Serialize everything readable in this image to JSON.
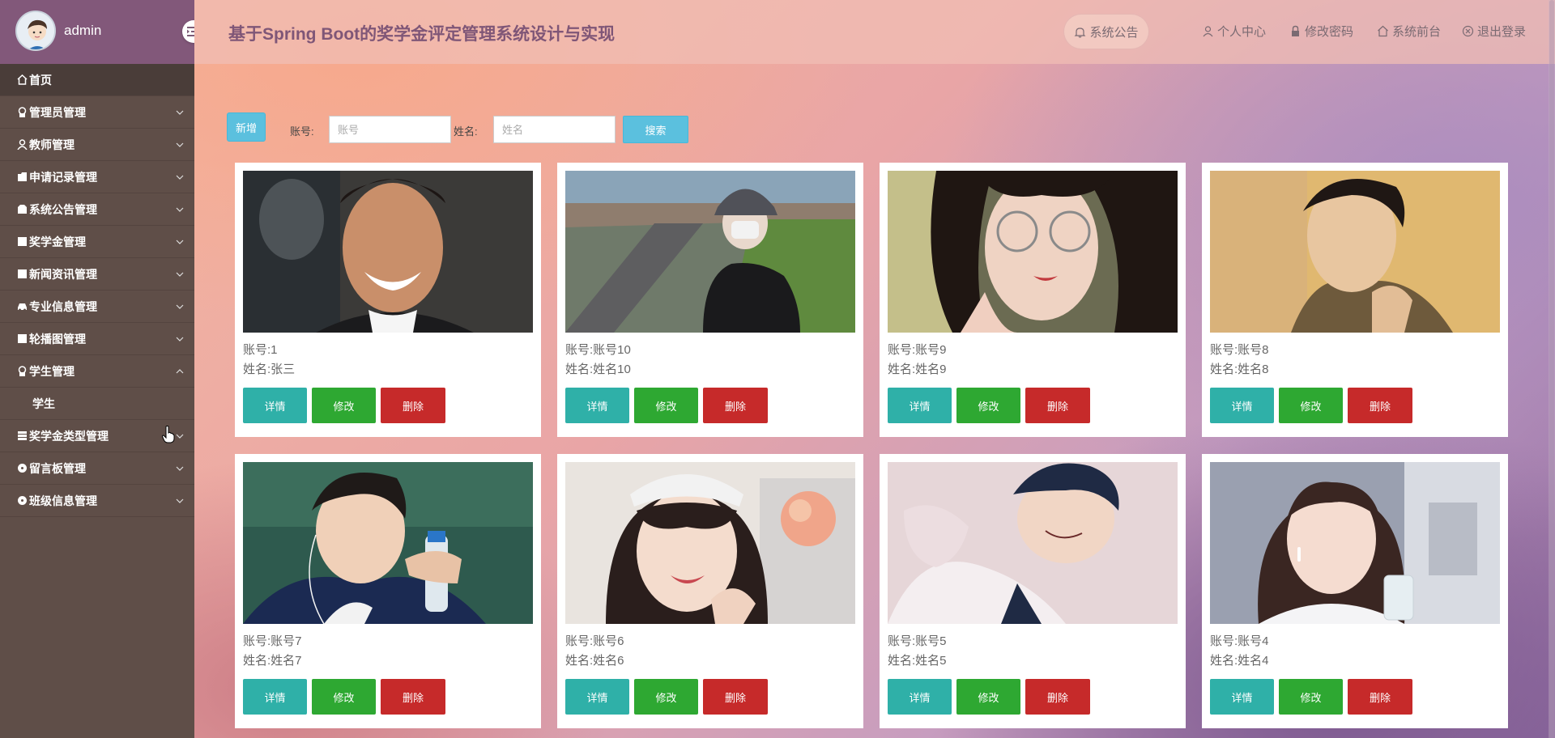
{
  "user": {
    "name": "admin"
  },
  "header": {
    "title": "基于Spring Boot的奖学金评定管理系统设计与实现",
    "notice": "系统公告",
    "links": {
      "profile": "个人中心",
      "password": "修改密码",
      "frontend": "系统前台",
      "logout": "退出登录"
    }
  },
  "sidebar": {
    "items": [
      {
        "label": "首页",
        "icon": "home-icon"
      },
      {
        "label": "管理员管理",
        "icon": "lock-icon"
      },
      {
        "label": "教师管理",
        "icon": "user-icon"
      },
      {
        "label": "申请记录管理",
        "icon": "folder-icon"
      },
      {
        "label": "系统公告管理",
        "icon": "bag-icon"
      },
      {
        "label": "奖学金管理",
        "icon": "square-icon"
      },
      {
        "label": "新闻资讯管理",
        "icon": "square-icon"
      },
      {
        "label": "专业信息管理",
        "icon": "car-icon"
      },
      {
        "label": "轮播图管理",
        "icon": "square-icon"
      },
      {
        "label": "学生管理",
        "icon": "lock-icon"
      },
      {
        "label": "奖学金类型管理",
        "icon": "list-icon"
      },
      {
        "label": "留言板管理",
        "icon": "circle-icon"
      },
      {
        "label": "班级信息管理",
        "icon": "circle-icon"
      }
    ],
    "student_sub": "学生"
  },
  "search": {
    "add_label": "新增",
    "account_label": "账号:",
    "account_placeholder": "账号",
    "name_label": "姓名:",
    "name_placeholder": "姓名",
    "search_label": "搜索"
  },
  "card_labels": {
    "account": "账号:",
    "name": "姓名:",
    "detail": "详情",
    "edit": "修改",
    "delete": "删除"
  },
  "cards": [
    {
      "account": "1",
      "name": "张三",
      "photo": "photo-smiling-young-man"
    },
    {
      "account": "账号10",
      "name": "姓名10",
      "photo": "photo-girl-masked-on-road"
    },
    {
      "account": "账号9",
      "name": "姓名9",
      "photo": "photo-girl-with-glasses"
    },
    {
      "account": "账号8",
      "name": "姓名8",
      "photo": "photo-young-man-warm-light"
    },
    {
      "account": "账号7",
      "name": "姓名7",
      "photo": "photo-young-man-with-bottle"
    },
    {
      "account": "账号6",
      "name": "姓名6",
      "photo": "photo-smiling-girl-with-peach"
    },
    {
      "account": "账号5",
      "name": "姓名5",
      "photo": "photo-anime-boy-illustration"
    },
    {
      "account": "账号4",
      "name": "姓名4",
      "photo": "photo-girl-with-glass-cup"
    }
  ]
}
